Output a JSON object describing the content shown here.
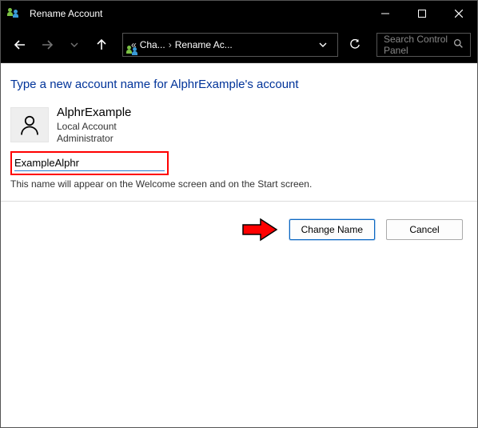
{
  "titlebar": {
    "title": "Rename Account"
  },
  "breadcrumb": {
    "seg1": "Cha...",
    "seg2": "Rename Ac..."
  },
  "search": {
    "placeholder": "Search Control Panel"
  },
  "page": {
    "heading": "Type a new account name for AlphrExample's account",
    "user_name": "AlphrExample",
    "user_type": "Local Account",
    "user_role": "Administrator",
    "input_value": "ExampleAlphr",
    "help": "This name will appear on the Welcome screen and on the Start screen."
  },
  "buttons": {
    "change": "Change Name",
    "cancel": "Cancel"
  }
}
